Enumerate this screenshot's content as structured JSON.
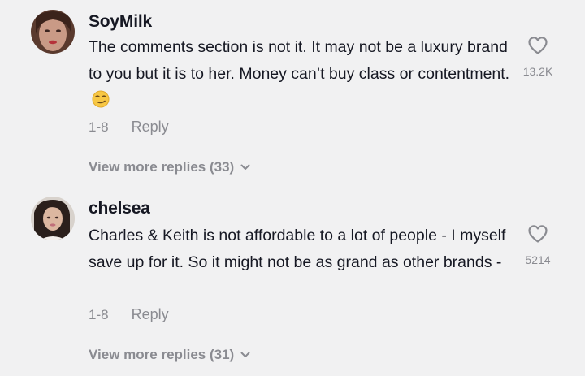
{
  "comments": [
    {
      "username": "SoyMilk",
      "text": "The comments section is not it. It may not be a luxury brand to you but it is to her. Money can’t buy class or contentment.",
      "emoji": "smirking-face",
      "likes": "13.2K",
      "date": "1-8",
      "reply_label": "Reply",
      "view_more": "View more replies (33)"
    },
    {
      "username": "chelsea",
      "text": "Charles & Keith is not affordable to a lot of people - I myself save up for it. So it might not be as grand as other brands -",
      "likes": "5214",
      "date": "1-8",
      "reply_label": "Reply",
      "view_more": "View more replies (31)"
    }
  ],
  "colors": {
    "background": "#f1f1f2",
    "text": "#161823",
    "muted": "#8a8b91"
  }
}
